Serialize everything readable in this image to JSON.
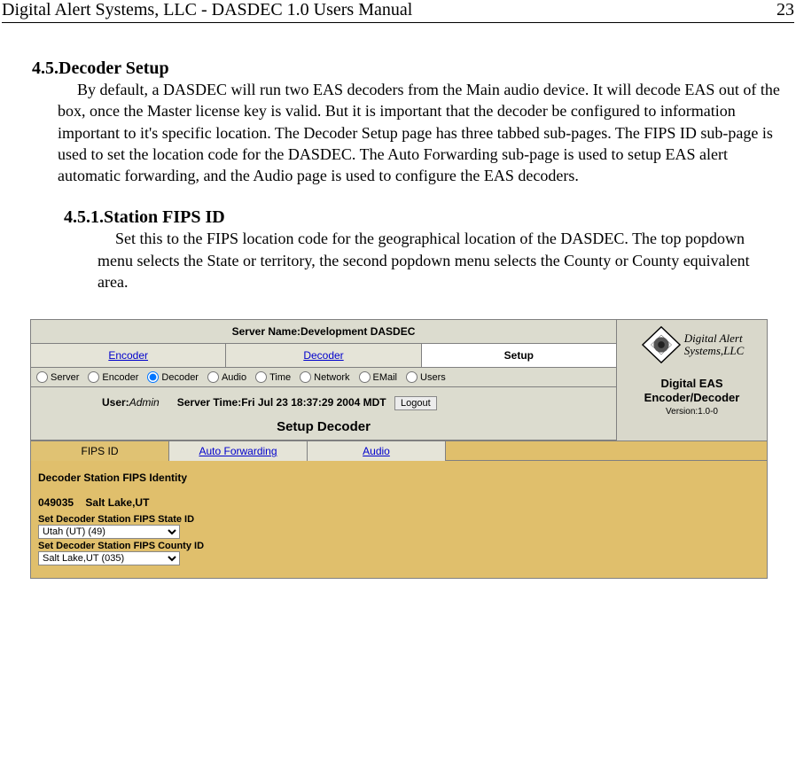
{
  "header": {
    "title": "Digital Alert Systems, LLC - DASDEC 1.0 Users Manual",
    "page_number": "23"
  },
  "section": {
    "number": "4.5.",
    "title": "Decoder Setup",
    "body": "By default, a DASDEC will run two EAS decoders from the Main audio device. It will decode EAS out of the box, once the Master license key is valid. But it is important that the decoder be configured to information important to it's specific location. The Decoder Setup page has three tabbed sub-pages. The FIPS ID sub-page is used to set the location code for the DASDEC. The Auto Forwarding sub-page is used to setup EAS alert automatic forwarding, and the Audio page is used to configure the EAS decoders."
  },
  "subsection": {
    "number": "4.5.1.",
    "title": "Station FIPS ID",
    "body": "Set this to the FIPS location code for the geographical location of the DASDEC. The top popdown menu selects the State or territory, the second popdown menu selects the County or County equivalent area."
  },
  "screenshot": {
    "server_name_label": "Server Name:",
    "server_name_value": "Development DASDEC",
    "main_tabs": [
      "Encoder",
      "Decoder",
      "Setup"
    ],
    "main_tab_active": 2,
    "radios": [
      "Server",
      "Encoder",
      "Decoder",
      "Audio",
      "Time",
      "Network",
      "EMail",
      "Users"
    ],
    "radio_selected": 2,
    "user_label": "User:",
    "user_value": "Admin",
    "server_time_label": "Server Time:",
    "server_time_value": "Fri Jul 23 18:37:29 2004 MDT",
    "logout_label": "Logout",
    "setup_title": "Setup Decoder",
    "brand_line1": "Digital Alert",
    "brand_line2": "Systems,LLC",
    "product_name1": "Digital EAS",
    "product_name2": "Encoder/Decoder",
    "version": "Version:1.0-0",
    "sub_tabs": [
      "FIPS ID",
      "Auto Forwarding",
      "Audio"
    ],
    "sub_tab_active": 0,
    "content": {
      "section_label": "Decoder Station FIPS Identity",
      "fips_code": "049035",
      "fips_name": "Salt Lake,UT",
      "state_label": "Set Decoder Station FIPS State ID",
      "state_value": "Utah (UT) (49)",
      "county_label": "Set Decoder Station FIPS County ID",
      "county_value": "Salt Lake,UT (035)"
    }
  }
}
